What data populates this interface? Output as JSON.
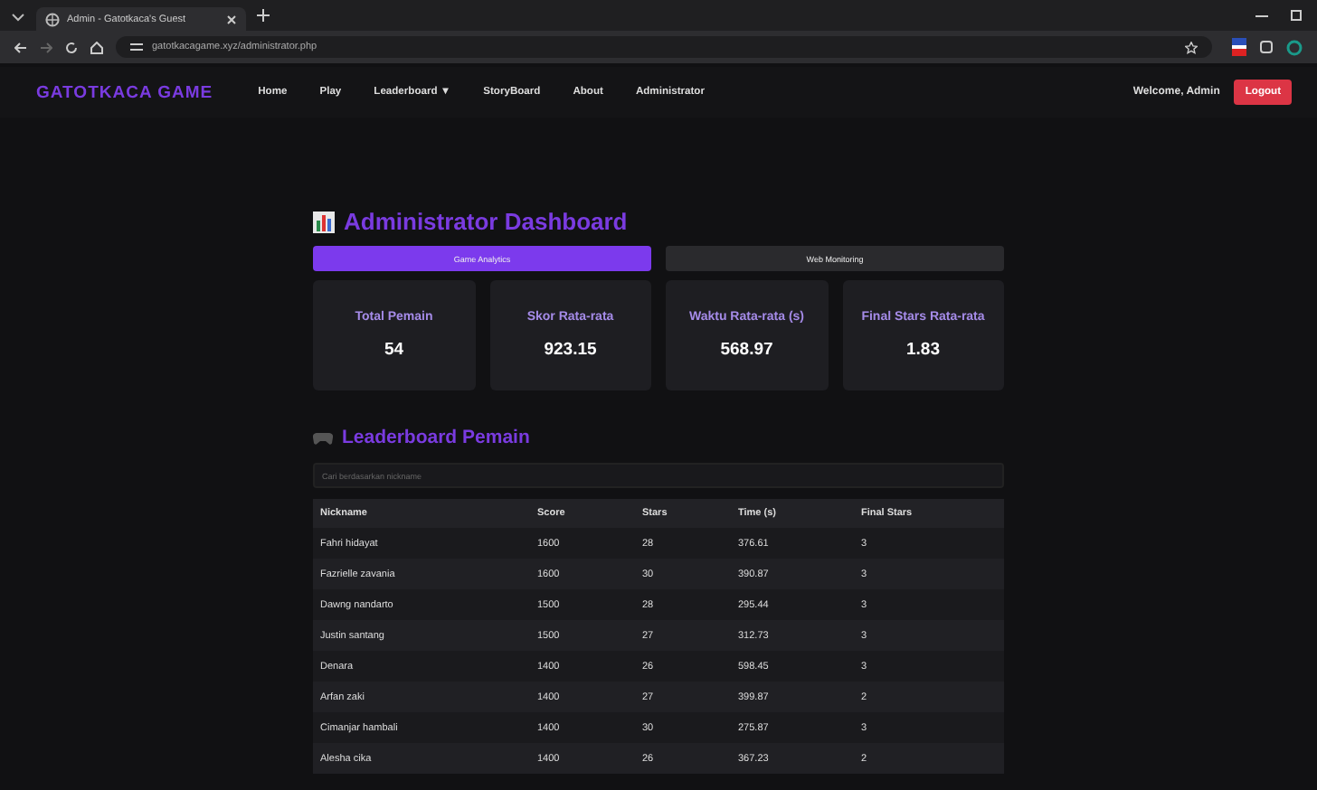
{
  "browser": {
    "tab_title": "Admin - Gatotkaca's Guest",
    "url": "gatotkacagame.xyz/administrator.php"
  },
  "nav": {
    "brand": "GATOTKACA GAME",
    "items": [
      {
        "label": "Home"
      },
      {
        "label": "Play"
      },
      {
        "label": "Leaderboard ▼"
      },
      {
        "label": "StoryBoard"
      },
      {
        "label": "About"
      },
      {
        "label": "Administrator"
      }
    ],
    "welcome": "Welcome, Admin",
    "logout": "Logout"
  },
  "title": "Administrator Dashboard",
  "tabs": [
    {
      "label": "Game Analytics",
      "selected": true
    },
    {
      "label": "Web Monitoring",
      "selected": false
    }
  ],
  "stats": [
    {
      "label": "Total Pemain",
      "value": "54"
    },
    {
      "label": "Skor Rata-rata",
      "value": "923.15"
    },
    {
      "label": "Waktu Rata-rata (s)",
      "value": "568.97"
    },
    {
      "label": "Final Stars Rata-rata",
      "value": "1.83"
    }
  ],
  "leaderboard": {
    "title": "Leaderboard Pemain",
    "search": {
      "placeholder": "Cari berdasarkan nickname"
    },
    "columns": [
      "Nickname",
      "Score",
      "Stars",
      "Time (s)",
      "Final Stars"
    ],
    "rows": [
      [
        "Fahri hidayat",
        "1600",
        "28",
        "376.61",
        "3"
      ],
      [
        "Fazrielle zavania",
        "1600",
        "30",
        "390.87",
        "3"
      ],
      [
        "Dawng nandarto",
        "1500",
        "28",
        "295.44",
        "3"
      ],
      [
        "Justin santang",
        "1500",
        "27",
        "312.73",
        "3"
      ],
      [
        "Denara",
        "1400",
        "26",
        "598.45",
        "3"
      ],
      [
        "Arfan zaki",
        "1400",
        "27",
        "399.87",
        "2"
      ],
      [
        "Cimanjar hambali",
        "1400",
        "30",
        "275.87",
        "3"
      ],
      [
        "Alesha cika",
        "1400",
        "26",
        "367.23",
        "2"
      ]
    ]
  }
}
